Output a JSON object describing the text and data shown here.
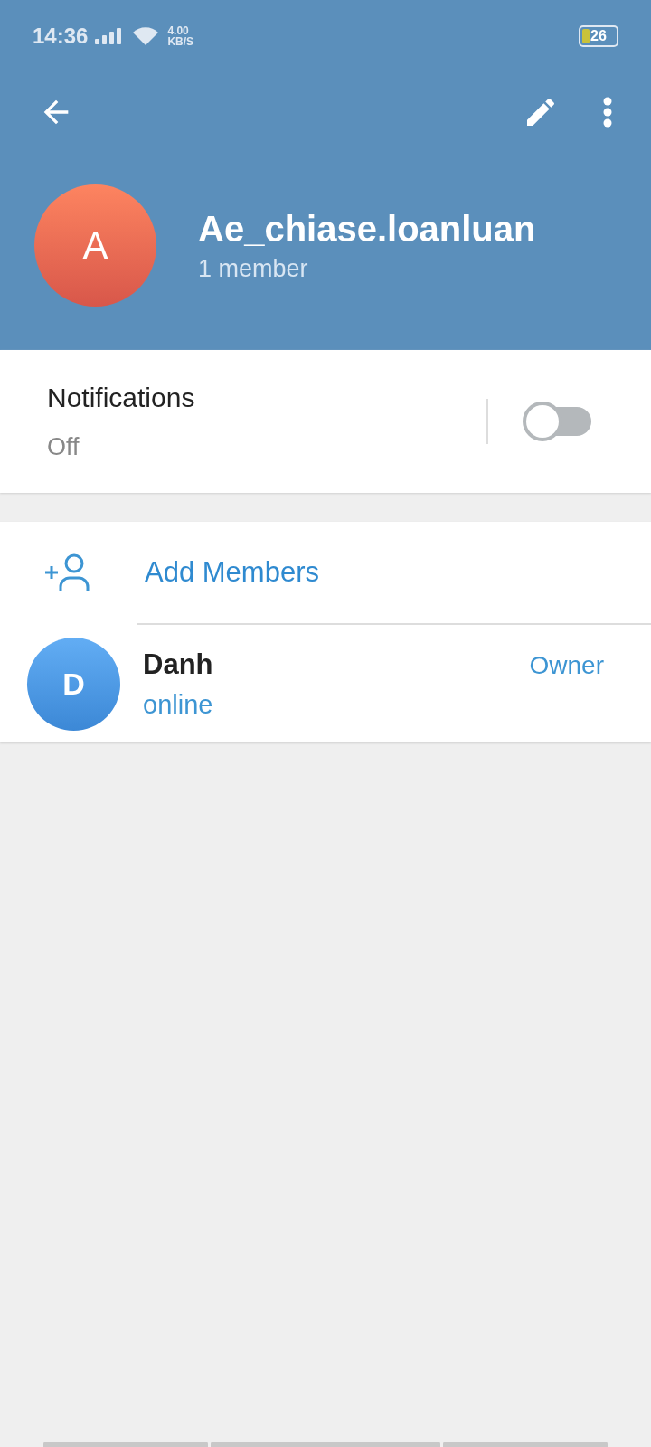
{
  "status_bar": {
    "time": "14:36",
    "speed_value": "4.00",
    "speed_unit": "KB/S",
    "battery": "26"
  },
  "group": {
    "avatar_letter": "A",
    "title": "Ae_chiase.loanluan",
    "subtitle": "1 member"
  },
  "notifications": {
    "label": "Notifications",
    "value": "Off",
    "on": false
  },
  "add_members": {
    "label": "Add Members"
  },
  "members": [
    {
      "avatar_letter": "D",
      "name": "Danh",
      "status": "online",
      "role": "Owner"
    }
  ]
}
